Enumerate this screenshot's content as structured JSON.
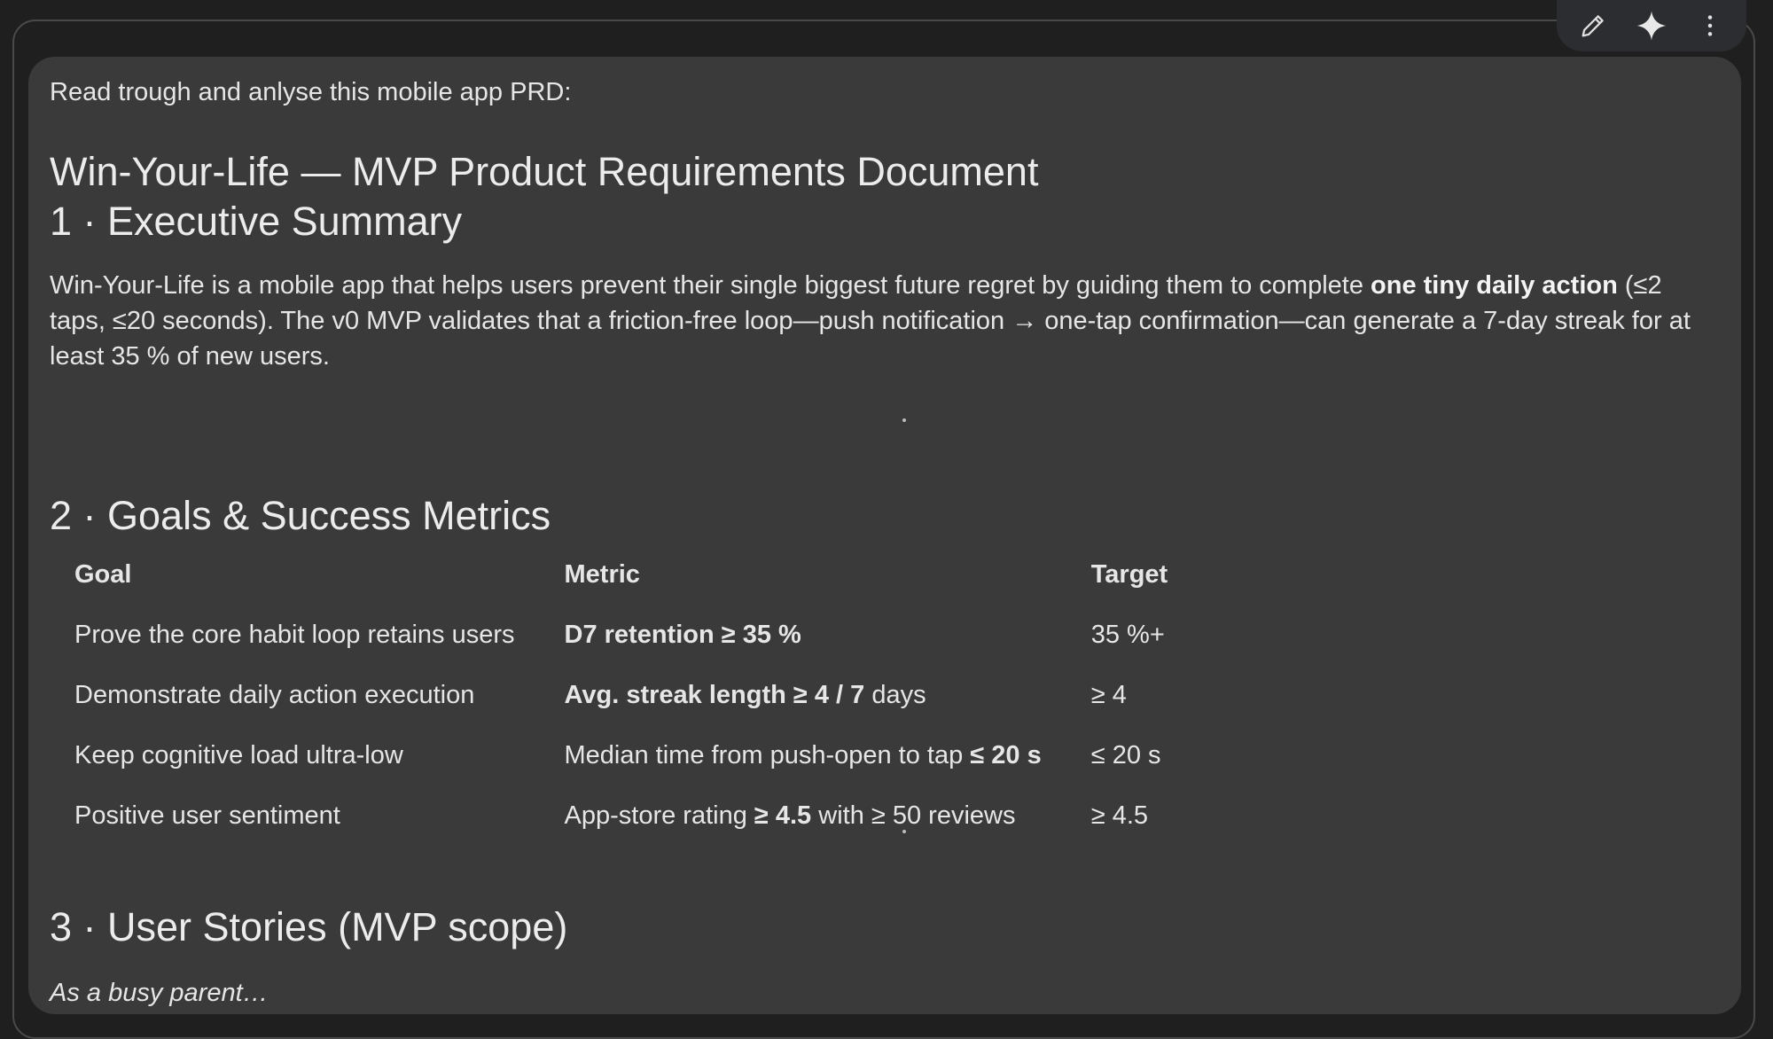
{
  "toolbar": {
    "edit_icon": "pencil-icon",
    "ai_icon": "sparkle-icon",
    "more_icon": "more-vertical-icon"
  },
  "message": {
    "prompt": "Read trough and anlyse this mobile app PRD:",
    "doc_title": "Win-Your-Life — MVP Product Requirements Document",
    "sections": {
      "exec": {
        "heading": "1 · Executive Summary",
        "summary_part1": "Win-Your-Life is a mobile app that helps users prevent their single biggest future regret by guiding them to complete ",
        "summary_bold": "one tiny daily action",
        "summary_part2": " (≤2 taps, ≤20 seconds). The v0 MVP validates that a friction-free loop—push notification → one-tap confirmation—can generate a 7-day streak for at least 35 % of new users."
      },
      "goals": {
        "heading": "2 · Goals & Success Metrics",
        "headers": [
          "Goal",
          "Metric",
          "Target"
        ],
        "rows": [
          {
            "goal": "Prove the core habit loop retains users",
            "metric_bold": "D7 retention ≥ 35 %",
            "metric_text": "",
            "metric_bold_end": "",
            "metric_text_end": "",
            "target": "35 %+"
          },
          {
            "goal": "Demonstrate daily action execution",
            "metric_bold": "Avg. streak length ≥ 4 / 7",
            "metric_text": " days",
            "metric_bold_end": "",
            "metric_text_end": "",
            "target": "≥ 4"
          },
          {
            "goal": "Keep cognitive load ultra-low",
            "metric_bold": "",
            "metric_text": "Median time from push-open to tap ",
            "metric_bold_end": "≤ 20 s",
            "metric_text_end": "",
            "target": "≤ 20 s"
          },
          {
            "goal": "Positive user sentiment",
            "metric_bold": "",
            "metric_text": "App-store rating ",
            "metric_bold_end": "≥ 4.5",
            "metric_text_end": " with ≥ 50 reviews",
            "target": "≥ 4.5"
          }
        ]
      },
      "stories": {
        "heading": "3 · User Stories (MVP scope)",
        "persona": "As a busy parent…"
      }
    }
  }
}
